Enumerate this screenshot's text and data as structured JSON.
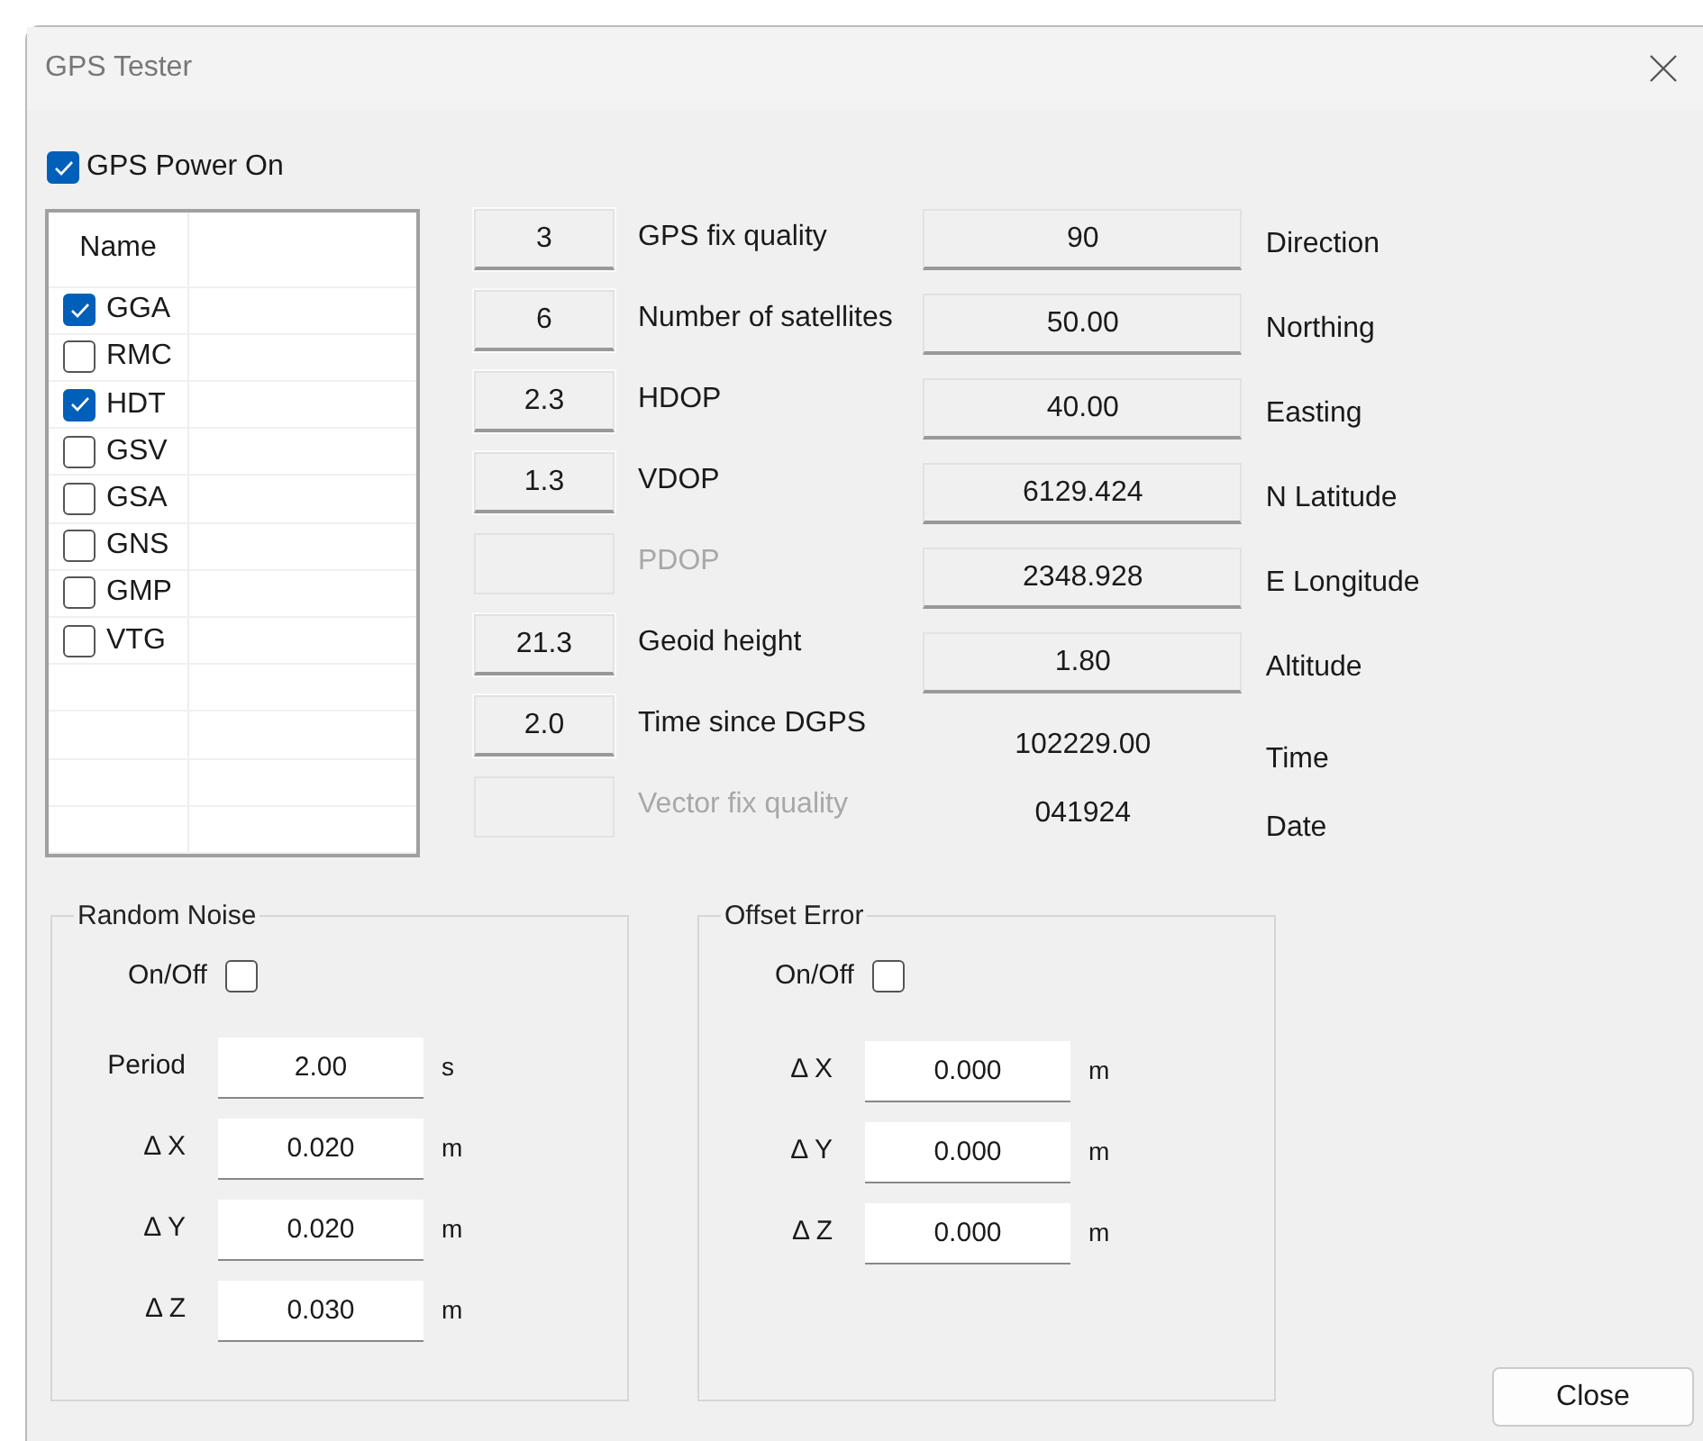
{
  "window": {
    "title": "GPS Tester"
  },
  "power": {
    "label": "GPS Power On",
    "checked": true
  },
  "sentences": {
    "column": "Name",
    "rows": [
      {
        "label": "GGA",
        "checked": true
      },
      {
        "label": "RMC",
        "checked": false
      },
      {
        "label": "HDT",
        "checked": true
      },
      {
        "label": "GSV",
        "checked": false
      },
      {
        "label": "GSA",
        "checked": false
      },
      {
        "label": "GNS",
        "checked": false
      },
      {
        "label": "GMP",
        "checked": false
      },
      {
        "label": "VTG",
        "checked": false
      }
    ]
  },
  "quality": [
    {
      "value": "3",
      "label": "GPS fix quality",
      "disabled": false
    },
    {
      "value": "6",
      "label": "Number of satellites",
      "disabled": false
    },
    {
      "value": "2.3",
      "label": "HDOP",
      "disabled": false
    },
    {
      "value": "1.3",
      "label": "VDOP",
      "disabled": false
    },
    {
      "label": "PDOP",
      "disabled": true
    },
    {
      "value": "21.3",
      "label": "Geoid height",
      "disabled": false
    },
    {
      "value": "2.0",
      "label": "Time since DGPS",
      "disabled": false
    },
    {
      "label": "Vector fix quality",
      "disabled": true
    }
  ],
  "position": [
    {
      "kind": "box",
      "value": "90",
      "label": "Direction"
    },
    {
      "kind": "box",
      "value": "50.00",
      "label": "Northing"
    },
    {
      "kind": "box",
      "value": "40.00",
      "label": "Easting"
    },
    {
      "kind": "box",
      "value": "6129.424",
      "label": "N Latitude"
    },
    {
      "kind": "box",
      "value": "2348.928",
      "label": "E Longitude"
    },
    {
      "kind": "box",
      "value": "1.80",
      "label": "Altitude"
    },
    {
      "kind": "plain",
      "value": "102229.00",
      "label": "Time"
    },
    {
      "kind": "plain",
      "value": "041924",
      "label": "Date"
    }
  ],
  "random_noise": {
    "title": "Random Noise",
    "toggle": {
      "label": "On/Off",
      "checked": false
    },
    "fields": [
      {
        "label": "Period",
        "value": "2.00",
        "unit": "s"
      },
      {
        "label": "Δ X",
        "value": "0.020",
        "unit": "m"
      },
      {
        "label": "Δ Y",
        "value": "0.020",
        "unit": "m"
      },
      {
        "label": "Δ Z",
        "value": "0.030",
        "unit": "m"
      }
    ]
  },
  "offset_error": {
    "title": "Offset Error",
    "toggle": {
      "label": "On/Off",
      "checked": false
    },
    "fields": [
      {
        "label": "Δ X",
        "value": "0.000",
        "unit": "m"
      },
      {
        "label": "Δ Y",
        "value": "0.000",
        "unit": "m"
      },
      {
        "label": "Δ Z",
        "value": "0.000",
        "unit": "m"
      }
    ]
  },
  "buttons": [
    {
      "label": "Close"
    }
  ]
}
